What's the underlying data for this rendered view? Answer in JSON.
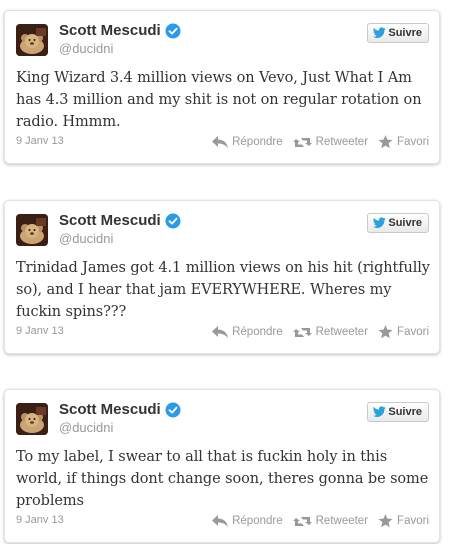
{
  "tweets": [
    {
      "author": "Scott Mescudi",
      "handle": "@ducidni",
      "follow_label": "Suivre",
      "text": "King Wizard 3.4 million views on Vevo, Just What I Am has 4.3 million and my shit is not on regular rotation on radio. Hmmm.",
      "date": "9 Janv 13",
      "reply_label": "Répondre",
      "retweet_label": "Retweeter",
      "favorite_label": "Favori"
    },
    {
      "author": "Scott Mescudi",
      "handle": "@ducidni",
      "follow_label": "Suivre",
      "text": "Trinidad James got 4.1 million views on his hit (rightfully so), and I hear that jam EVERYWHERE. Wheres my fuckin spins???",
      "date": "9 Janv 13",
      "reply_label": "Répondre",
      "retweet_label": "Retweeter",
      "favorite_label": "Favori"
    },
    {
      "author": "Scott Mescudi",
      "handle": "@ducidni",
      "follow_label": "Suivre",
      "text": "To my label, I swear to all that is fuckin holy in this world, if things dont change soon, theres gonna be some problems",
      "date": "9 Janv 13",
      "reply_label": "Répondre",
      "retweet_label": "Retweeter",
      "favorite_label": "Favori"
    }
  ],
  "icons": {
    "verified": "verified-check-icon",
    "follow": "twitter-bird-icon",
    "reply": "reply-arrow-icon",
    "retweet": "retweet-icon",
    "favorite": "star-icon"
  },
  "colors": {
    "verified_blue": "#2b9ae8",
    "bird_blue": "#2aa3dd",
    "muted_text": "#999999"
  }
}
